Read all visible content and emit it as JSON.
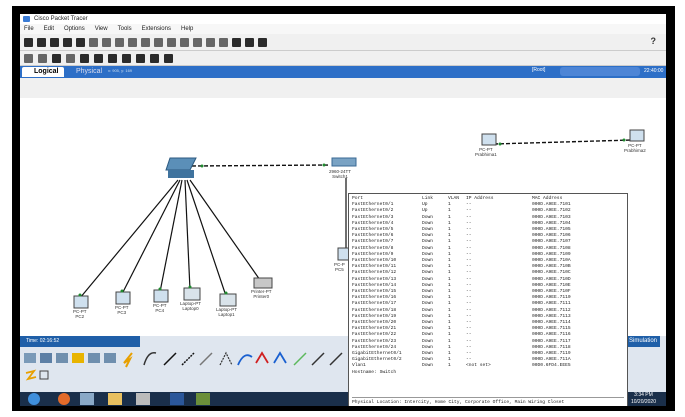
{
  "app": {
    "title": "Cisco Packet Tracer"
  },
  "menu": [
    "File",
    "Edit",
    "Options",
    "View",
    "Tools",
    "Extensions",
    "Help"
  ],
  "help_label": "?",
  "tabs": {
    "logical": "Logical",
    "physical": "Physical",
    "coords": "x: 905, y: 169",
    "root": "[Root]",
    "time": "22:40:00"
  },
  "devices": {
    "switch0": "",
    "switch1_model": "2960-24TT",
    "switch1_name": "Switch1",
    "pc_rp1_model": "PC-PT",
    "pc_rp1_name": "Prabhima1",
    "pc_rp2_model": "PC-PT",
    "pc_rp2_name": "Prabhima2",
    "pc2_model": "PC-PT",
    "pc2_name": "PC2",
    "pc3_model": "PC-PT",
    "pc3_name": "PC3",
    "pc4_model": "PC-PT",
    "pc4_name": "PC4",
    "laptop0_model": "Laptop-PT",
    "laptop0_name": "Laptop0",
    "laptop1_model": "Laptop-PT",
    "laptop1_name": "Laptop1",
    "printer_model": "Printer-PT",
    "printer_name": "Printer0",
    "pc5_model": "PC-P",
    "pc5_name": "PC5"
  },
  "bottom": {
    "time": "Time: 02:16:52",
    "realtime": "me",
    "simulation": "Simulation"
  },
  "clock": {
    "time": "3:34 PM",
    "date": "10/20/2020"
  },
  "popup": {
    "headers": [
      "Port",
      "Link",
      "VLAN",
      "IP Address",
      "MAC Address"
    ],
    "rows": [
      [
        "FastEthernet0/1",
        "Up",
        "1",
        "--",
        "000D.A9EE.7101"
      ],
      [
        "FastEthernet0/2",
        "Up",
        "1",
        "--",
        "000D.A9EE.7102"
      ],
      [
        "FastEthernet0/3",
        "Down",
        "1",
        "--",
        "000D.A9EE.7103"
      ],
      [
        "FastEthernet0/4",
        "Down",
        "1",
        "--",
        "000D.A9EE.7104"
      ],
      [
        "FastEthernet0/5",
        "Down",
        "1",
        "--",
        "000D.A9EE.7105"
      ],
      [
        "FastEthernet0/6",
        "Down",
        "1",
        "--",
        "000D.A9EE.7106"
      ],
      [
        "FastEthernet0/7",
        "Down",
        "1",
        "--",
        "000D.A9EE.7107"
      ],
      [
        "FastEthernet0/8",
        "Down",
        "1",
        "--",
        "000D.A9EE.7108"
      ],
      [
        "FastEthernet0/9",
        "Down",
        "1",
        "--",
        "000D.A9EE.7109"
      ],
      [
        "FastEthernet0/10",
        "Down",
        "1",
        "--",
        "000D.A9EE.710A"
      ],
      [
        "FastEthernet0/11",
        "Down",
        "1",
        "--",
        "000D.A9EE.710B"
      ],
      [
        "FastEthernet0/12",
        "Down",
        "1",
        "--",
        "000D.A9EE.710C"
      ],
      [
        "FastEthernet0/13",
        "Down",
        "1",
        "--",
        "000D.A9EE.710D"
      ],
      [
        "FastEthernet0/14",
        "Down",
        "1",
        "--",
        "000D.A9EE.710E"
      ],
      [
        "FastEthernet0/15",
        "Down",
        "1",
        "--",
        "000D.A9EE.710F"
      ],
      [
        "FastEthernet0/16",
        "Down",
        "1",
        "--",
        "000D.A9EE.7110"
      ],
      [
        "FastEthernet0/17",
        "Down",
        "1",
        "--",
        "000D.A9EE.7111"
      ],
      [
        "FastEthernet0/18",
        "Down",
        "1",
        "--",
        "000D.A9EE.7112"
      ],
      [
        "FastEthernet0/19",
        "Down",
        "1",
        "--",
        "000D.A9EE.7113"
      ],
      [
        "FastEthernet0/20",
        "Down",
        "1",
        "--",
        "000D.A9EE.7114"
      ],
      [
        "FastEthernet0/21",
        "Down",
        "1",
        "--",
        "000D.A9EE.7115"
      ],
      [
        "FastEthernet0/22",
        "Down",
        "1",
        "--",
        "000D.A9EE.7116"
      ],
      [
        "FastEthernet0/23",
        "Down",
        "1",
        "--",
        "000D.A9EE.7117"
      ],
      [
        "FastEthernet0/24",
        "Down",
        "1",
        "--",
        "000D.A9EE.7118"
      ],
      [
        "GigabitEthernet0/1",
        "Down",
        "1",
        "--",
        "000D.A9EE.7119"
      ],
      [
        "GigabitEthernet0/2",
        "Down",
        "1",
        "--",
        "000D.A9EE.711A"
      ],
      [
        "Vlan1",
        "Down",
        "1",
        "<not set>",
        "00D0.6FD4.EEE5"
      ]
    ],
    "hostname": "Hostname: Switch",
    "location": "Physical Location: Intercity, Home City, Corporate Office, Main Wiring Closet"
  },
  "colors": {
    "accent": "#2d6fc7",
    "link_up": "#1f8a2f",
    "link_line": "#111111"
  }
}
